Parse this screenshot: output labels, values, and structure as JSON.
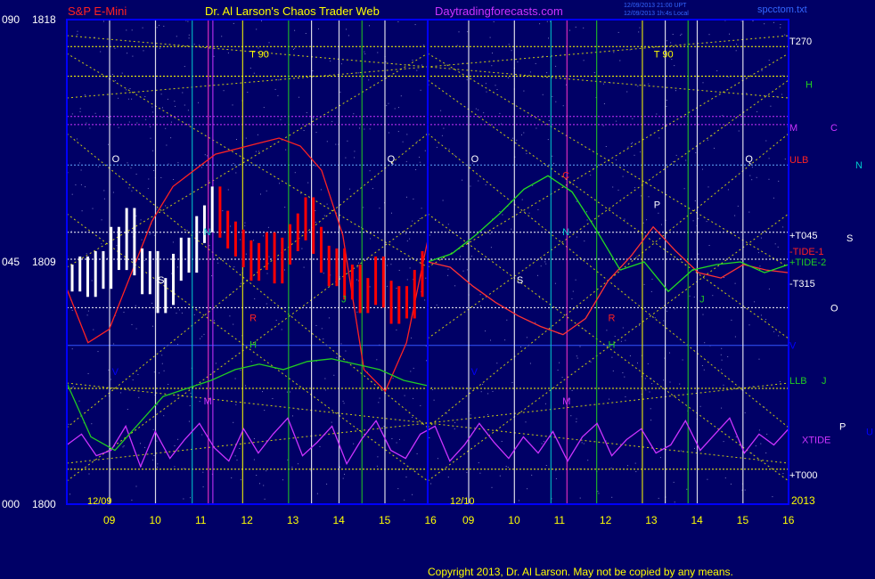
{
  "header": {
    "symbol": "S&P E-Mini",
    "title": "Dr. Al Larson's Chaos Trader Web",
    "site": "Daytradingforecasts.com",
    "stamp1": "12/09/2013 21:00 UPT",
    "stamp2": "12/09/2013 1h:4s Local",
    "file": "spcctom.txt"
  },
  "footer": {
    "copyright": "Copyright 2013, Dr. Al Larson. May not be copied by any means."
  },
  "colors": {
    "background": "#000066",
    "frame": "#0000ff",
    "grid": "#ffff00",
    "price_up": "#ffffff",
    "price_down": "#ff0000",
    "xtide": "#cc33ff",
    "ulb": "#ff2222",
    "llb": "#22cc22",
    "m_line": "#cc33ff",
    "o_line": "#66aaff"
  },
  "chart_data": {
    "type": "line",
    "title": "S&P E-Mini",
    "y_tick_labels": [
      {
        "left": "090",
        "price": "1818"
      },
      {
        "left": "045",
        "price": "1809"
      },
      {
        "left": "000",
        "price": "1800"
      }
    ],
    "ylim": [
      1800,
      1818
    ],
    "x_tick_labels": [
      "09",
      "10",
      "11",
      "12",
      "13",
      "14",
      "15",
      "16",
      "09",
      "10",
      "11",
      "12",
      "13",
      "14",
      "15",
      "16"
    ],
    "date_labels": [
      "12/09",
      "12/10"
    ],
    "year_label": "2013",
    "right_labels": [
      {
        "text": "T270",
        "price": 1817.2,
        "color": "#ffffff"
      },
      {
        "text": "H",
        "price": 1815.6,
        "color": "#22cc22",
        "offset": 18
      },
      {
        "text": "M",
        "price": 1814.0,
        "color": "#cc33ff"
      },
      {
        "text": "C",
        "price": 1814.0,
        "color": "#cc33ff",
        "offset": 46
      },
      {
        "text": "N",
        "price": 1812.6,
        "color": "#00cccc",
        "offset": 74
      },
      {
        "text": "ULB",
        "price": 1812.8,
        "color": "#ff2222"
      },
      {
        "text": "+T045",
        "price": 1810.0,
        "color": "#ffffff"
      },
      {
        "text": "S",
        "price": 1809.9,
        "color": "#ffffff",
        "offset": 64
      },
      {
        "text": "-TIDE-1",
        "price": 1809.4,
        "color": "#ff2222"
      },
      {
        "text": "+TIDE-2",
        "price": 1809.0,
        "color": "#22cc22"
      },
      {
        "text": "-T315",
        "price": 1808.2,
        "color": "#ffffff"
      },
      {
        "text": "O",
        "price": 1807.3,
        "color": "#ffffff",
        "offset": 46
      },
      {
        "text": "V",
        "price": 1805.9,
        "color": "#0000ff"
      },
      {
        "text": "LLB",
        "price": 1804.6,
        "color": "#22cc22"
      },
      {
        "text": "J",
        "price": 1804.6,
        "color": "#22cc22",
        "offset": 36
      },
      {
        "text": "P",
        "price": 1802.9,
        "color": "#ffffff",
        "offset": 56
      },
      {
        "text": "U",
        "price": 1802.7,
        "color": "#0000ff",
        "offset": 86
      },
      {
        "text": "XTIDE",
        "price": 1802.4,
        "color": "#cc33ff",
        "offset": 14
      },
      {
        "text": "+T000",
        "price": 1801.1,
        "color": "#ffffff"
      }
    ],
    "chart_letters": [
      {
        "text": "T 90",
        "x": "12",
        "day": 1,
        "price": 1816.6,
        "color": "#ffff00"
      },
      {
        "text": "T 90",
        "x": "13",
        "day": 2,
        "price": 1816.6,
        "color": "#ffff00"
      },
      {
        "text": "O",
        "x": "09",
        "day": 1,
        "price": 1812.7,
        "color": "#ffffff"
      },
      {
        "text": "Q",
        "x": "15",
        "day": 1,
        "price": 1812.7,
        "color": "#ffffff"
      },
      {
        "text": "O",
        "x": "09",
        "day": 2,
        "price": 1812.7,
        "color": "#ffffff"
      },
      {
        "text": "Q",
        "x": "15",
        "day": 2,
        "price": 1812.7,
        "color": "#ffffff"
      },
      {
        "text": "N",
        "x": "11",
        "day": 1,
        "price": 1810.0,
        "color": "#00cccc"
      },
      {
        "text": "N",
        "x": "11",
        "day": 2,
        "price": 1810.0,
        "color": "#00cccc"
      },
      {
        "text": "S",
        "x": "10",
        "day": 1,
        "price": 1808.2,
        "color": "#ffffff"
      },
      {
        "text": "S",
        "x": "10",
        "day": 2,
        "price": 1808.2,
        "color": "#ffffff"
      },
      {
        "text": "C",
        "x": "11",
        "day": 2,
        "price": 1812.1,
        "color": "#ff2222"
      },
      {
        "text": "P",
        "x": "13",
        "day": 2,
        "price": 1811.0,
        "color": "#ffffff"
      },
      {
        "text": "R",
        "x": "12",
        "day": 1,
        "price": 1806.8,
        "color": "#ff2222"
      },
      {
        "text": "R",
        "x": "12",
        "day": 2,
        "price": 1806.8,
        "color": "#ff2222"
      },
      {
        "text": "H",
        "x": "12",
        "day": 1,
        "price": 1805.8,
        "color": "#22cc22"
      },
      {
        "text": "H",
        "x": "12",
        "day": 2,
        "price": 1805.8,
        "color": "#22cc22"
      },
      {
        "text": "J",
        "x": "14",
        "day": 1,
        "price": 1807.5,
        "color": "#22cc22"
      },
      {
        "text": "J",
        "x": "14",
        "day": 2,
        "price": 1807.5,
        "color": "#22cc22"
      },
      {
        "text": "M",
        "x": "11",
        "day": 1,
        "price": 1803.7,
        "color": "#cc33ff"
      },
      {
        "text": "M",
        "x": "11",
        "day": 2,
        "price": 1803.7,
        "color": "#cc33ff"
      },
      {
        "text": "V",
        "x": "09",
        "day": 1,
        "price": 1804.8,
        "color": "#0000ff"
      },
      {
        "text": "V",
        "x": "09",
        "day": 2,
        "price": 1804.8,
        "color": "#0000ff"
      }
    ],
    "horizontal_levels": [
      {
        "price": 1817.0,
        "color": "#ffff00",
        "style": "dotted"
      },
      {
        "price": 1815.9,
        "color": "#ffff00",
        "style": "dotted"
      },
      {
        "price": 1814.4,
        "color": "#cc33ff",
        "style": "dotted"
      },
      {
        "price": 1814.1,
        "color": "#cc33ff",
        "style": "dotted"
      },
      {
        "price": 1812.6,
        "color": "#66aaff",
        "style": "dotted"
      },
      {
        "price": 1810.1,
        "color": "#ffffff",
        "style": "dotted"
      },
      {
        "price": 1809.1,
        "color": "#ffffff",
        "style": "dotted"
      },
      {
        "price": 1807.3,
        "color": "#ffffff",
        "style": "dotted"
      },
      {
        "price": 1805.9,
        "color": "#3355ff",
        "style": "solid"
      },
      {
        "price": 1804.3,
        "color": "#ffff00",
        "style": "dotted"
      },
      {
        "price": 1801.3,
        "color": "#ffff00",
        "style": "dotted"
      }
    ],
    "vertical_lines": [
      {
        "day": 1,
        "x": "09.0",
        "color": "#ffffff"
      },
      {
        "day": 1,
        "x": "10.0",
        "color": "#ffffff"
      },
      {
        "day": 1,
        "x": "10.8",
        "color": "#00cccc"
      },
      {
        "day": 1,
        "x": "11.15",
        "color": "#ff33cc"
      },
      {
        "day": 1,
        "x": "11.25",
        "color": "#cc33ff"
      },
      {
        "day": 1,
        "x": "11.9",
        "color": "#ffff00"
      },
      {
        "day": 1,
        "x": "12.9",
        "color": "#22cc22"
      },
      {
        "day": 1,
        "x": "13.4",
        "color": "#ffffff"
      },
      {
        "day": 1,
        "x": "14.0",
        "color": "#ffffff"
      },
      {
        "day": 1,
        "x": "14.5",
        "color": "#22cc22"
      },
      {
        "day": 1,
        "x": "15.0",
        "color": "#ffffff"
      },
      {
        "day": 2,
        "x": "09.0",
        "color": "#ffffff"
      },
      {
        "day": 2,
        "x": "10.0",
        "color": "#ffffff"
      },
      {
        "day": 2,
        "x": "10.8",
        "color": "#00cccc"
      },
      {
        "day": 2,
        "x": "11.15",
        "color": "#ff33cc"
      },
      {
        "day": 2,
        "x": "11.8",
        "color": "#22cc22"
      },
      {
        "day": 2,
        "x": "12.8",
        "color": "#ffff00"
      },
      {
        "day": 2,
        "x": "13.3",
        "color": "#ffffff"
      },
      {
        "day": 2,
        "x": "13.8",
        "color": "#22cc22"
      },
      {
        "day": 2,
        "x": "14.0",
        "color": "#ffffff"
      },
      {
        "day": 2,
        "x": "15.0",
        "color": "#ffffff"
      }
    ],
    "series": [
      {
        "name": "price",
        "kind": "bars",
        "ohlc_close": [
          1808.4,
          1808.7,
          1808.2,
          1808.9,
          1808.5,
          1809.8,
          1809.2,
          1810.5,
          1809.0,
          1808.3,
          1808.9,
          1807.6,
          1807.9,
          1808.8,
          1809.4,
          1809.1,
          1810.2,
          1810.6,
          1811.3,
          1810.4,
          1810.0,
          1809.7,
          1809.3,
          1808.8,
          1809.2,
          1809.6,
          1808.7,
          1809.4,
          1809.9,
          1810.3,
          1810.9,
          1809.8,
          1809.1,
          1808.6,
          1809.0,
          1808.1,
          1808.4,
          1807.6,
          1807.9,
          1808.7,
          1807.8,
          1807.2,
          1807.6,
          1807.4,
          1808.2,
          1808.9
        ],
        "rising_until_index": 18
      },
      {
        "name": "XTIDE",
        "kind": "line",
        "values": [
          1802.2,
          1802.6,
          1801.8,
          1802.0,
          1802.9,
          1801.4,
          1802.7,
          1801.7,
          1802.4,
          1803.0,
          1802.1,
          1801.6,
          1802.8,
          1801.9,
          1802.6,
          1803.2,
          1801.8,
          1802.3,
          1802.9,
          1801.5,
          1802.4,
          1803.1,
          1802.0,
          1801.7,
          1802.6,
          1802.9,
          1801.6,
          1802.2,
          1803.0,
          1802.3,
          1801.7,
          1802.5,
          1801.9,
          1802.7,
          1801.6,
          1802.5,
          1803.0,
          1801.8,
          1802.4,
          1802.8,
          1801.9,
          1802.2,
          1803.1,
          1802.0,
          1802.6,
          1803.2,
          1801.9,
          1802.6,
          1802.2,
          1802.8
        ]
      },
      {
        "name": "ULB",
        "kind": "line",
        "values": [
          1808.0,
          1806.0,
          1806.5,
          1808.5,
          1810.5,
          1811.8,
          1812.4,
          1813.0,
          1813.2,
          1813.4,
          1813.6,
          1813.3,
          1812.4,
          1810.0,
          1805.0,
          1804.2,
          1806.0,
          1809.8
        ]
      },
      {
        "name": "LLB",
        "kind": "line",
        "values": [
          1804.5,
          1802.5,
          1802.0,
          1803.0,
          1804.0,
          1804.3,
          1804.6,
          1805.0,
          1805.2,
          1805.0,
          1805.3,
          1805.4,
          1805.2,
          1805.0,
          1804.6,
          1804.4
        ]
      },
      {
        "name": "TIDE-1",
        "kind": "line",
        "values": [
          1809.0,
          1808.8,
          1808.1,
          1807.5,
          1807.0,
          1806.6,
          1806.3,
          1806.9,
          1808.3,
          1809.2,
          1810.3,
          1809.4,
          1808.6,
          1808.4,
          1808.9,
          1808.7,
          1808.6
        ]
      },
      {
        "name": "TIDE-2",
        "kind": "line",
        "values": [
          1809.0,
          1809.3,
          1810.0,
          1810.8,
          1811.7,
          1812.2,
          1811.6,
          1810.2,
          1808.7,
          1809.0,
          1807.9,
          1808.7,
          1808.9,
          1809.0,
          1808.6,
          1808.9
        ]
      }
    ]
  }
}
